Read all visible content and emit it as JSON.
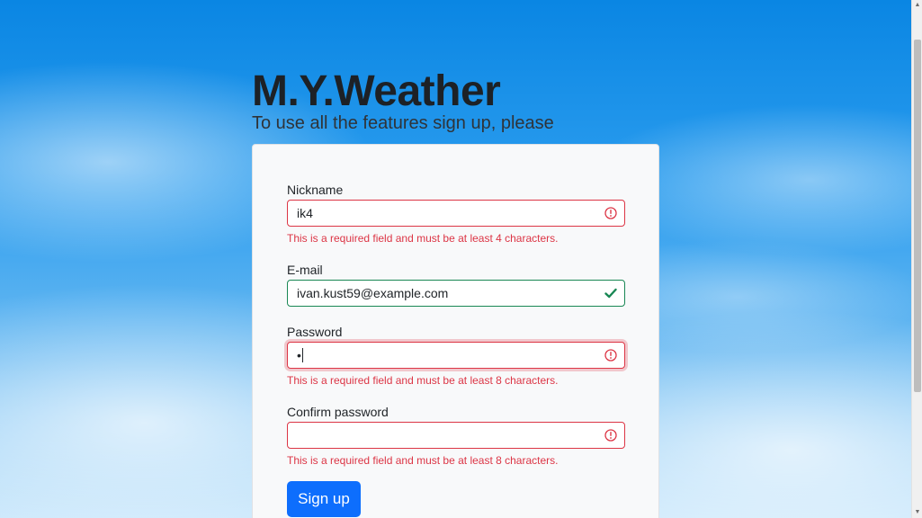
{
  "header": {
    "title": "M.Y.Weather",
    "subtitle": "To use all the features sign up, please"
  },
  "form": {
    "nickname": {
      "label": "Nickname",
      "value": "ik4",
      "state": "invalid",
      "error": "This is a required field and must be at least 4 characters."
    },
    "email": {
      "label": "E-mail",
      "value": "ivan.kust59@example.com",
      "state": "valid"
    },
    "password": {
      "label": "Password",
      "value": "•",
      "state": "invalid",
      "focused": true,
      "error": "This is a required field and must be at least 8 characters."
    },
    "confirm_password": {
      "label": "Confirm password",
      "value": "",
      "state": "invalid",
      "error": "This is a required field and must be at least 8 characters."
    },
    "submit_label": "Sign up"
  },
  "icons": {
    "invalid": "alert-circle-icon",
    "valid": "checkmark-icon"
  },
  "colors": {
    "error": "#dc3545",
    "valid": "#198754",
    "primary": "#0d6efd",
    "card_bg": "#f8f9fa"
  }
}
